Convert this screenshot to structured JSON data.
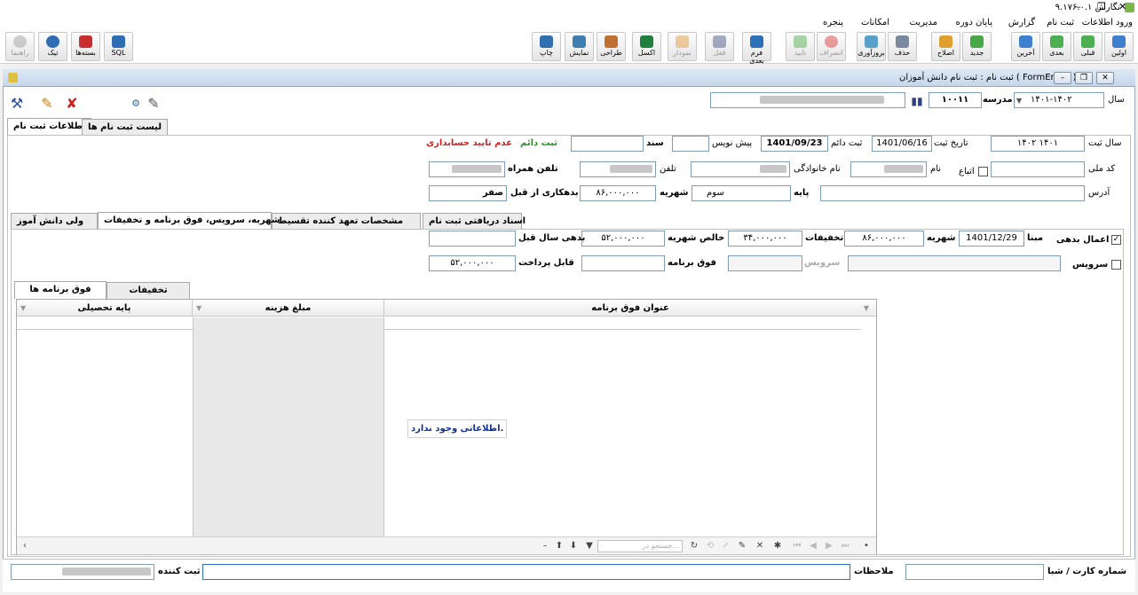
{
  "window": {
    "title": "نگارش ۹.۱۷۶.۰.۱",
    "min": "–",
    "restore": "❐",
    "close": "✕"
  },
  "menu": [
    "ورود اطلاعات",
    "ثبت نام",
    "گزارش",
    "پایان دوره",
    "مدیریت",
    "امکانات",
    "پنجره"
  ],
  "toolbar": {
    "first": "اولین",
    "prev": "قبلی",
    "next": "بعدی",
    "last": "آخرین",
    "new": "جدید",
    "edit": "اصلاح",
    "delete": "حذف",
    "refresh": "بروزآوری",
    "cancel": "انصراف",
    "confirm": "تایید",
    "sample": "فرم بعدی",
    "lock": "قفل",
    "report": "نمودار",
    "excel": "اکسل",
    "design": "طراحی",
    "view": "نمایش",
    "print": "چاپ",
    "sql": "SQL",
    "gift": "بسته‌ها",
    "support": "تیک",
    "help": "راهنما"
  },
  "form": {
    "title": "ثبت نام : ثبت نام دانش آموزان ( FormEnroll )",
    "year_label": "سال",
    "year_value": "۱۴۰۱-۱۴۰۲",
    "school_label": "مدرسه",
    "school_code": "۱۰۰۱۱",
    "tabs": {
      "info": "اطلاعات ثبت نام",
      "list": "لیست ثبت نام ها"
    },
    "reg_year_label": "سال ثبت",
    "reg_year_value": "۱۴۰۲ ۱۴۰۱",
    "reg_date_label": "تاریخ ثبت",
    "reg_date_value": "1401/06/16",
    "perm_label": "ثبت دائم",
    "perm_date_value": "1401/09/23",
    "draft_label": "پیش نویس",
    "doc_label": "سند",
    "status_perm": "ثبت دائم",
    "status_unconfirmed": "عدم تایید حسابداری",
    "national_label": "کد ملی",
    "nationality_label": "اتباع",
    "name_label": "نام",
    "family_label": "نام خانوادگی",
    "phone_label": "تلفن",
    "mobile_label": "تلفن همراه",
    "address_label": "آدرس",
    "grade_label": "پایه",
    "grade_value": "سوم",
    "tuition_label": "شهریه",
    "tuition_value": "۸۶,۰۰۰,۰۰۰",
    "prev_credit_label": "بدهکاری از قبل",
    "prev_credit_value": "صفر",
    "inner_tabs": {
      "docs": "اسناد دریافتی ثبت نام",
      "guarantor": "مشخصات تعهد کننده تقسیط",
      "tuition": "شهریه، سرویس، فوق برنامه و تخفیفات",
      "parent": "ولی دانش آموز"
    },
    "apply_debt_label": "اعمال بدهی",
    "apply_debt_checked": "✓",
    "base_label": "مبنا",
    "base_date_value": "1401/12/29",
    "tuition2_label": "شهریه",
    "tuition2_value": "۸۶,۰۰۰,۰۰۰",
    "discount_label": "تخفیفات",
    "discount_value": "۳۴,۰۰۰,۰۰۰",
    "net_label": "خالص شهریه",
    "net_value": "۵۲,۰۰۰,۰۰۰",
    "last_year_debt_label": "بدهی سال قبل",
    "service_label": "سرویس",
    "service_field_label": "سرویس",
    "extra_label": "فوق برنامه",
    "payable_label": "قابل پرداخت",
    "payable_value": "۵۲,۰۰۰,۰۰۰",
    "sub_tabs": {
      "extras": "فوق برنامه ها",
      "discounts": "تخفیفات"
    },
    "grid_cols": {
      "title": "عنوان فوق برنامه",
      "amount": "مبلغ هزینه",
      "grade": "پایه تحصیلی"
    },
    "empty_message": "اطلاعاتی وجود ندارد.",
    "search_placeholder": "جستجو در...",
    "card_label": "شماره کارت / شبا",
    "notes_label": "ملاحظات",
    "registrar_label": "ثبت کننده"
  }
}
